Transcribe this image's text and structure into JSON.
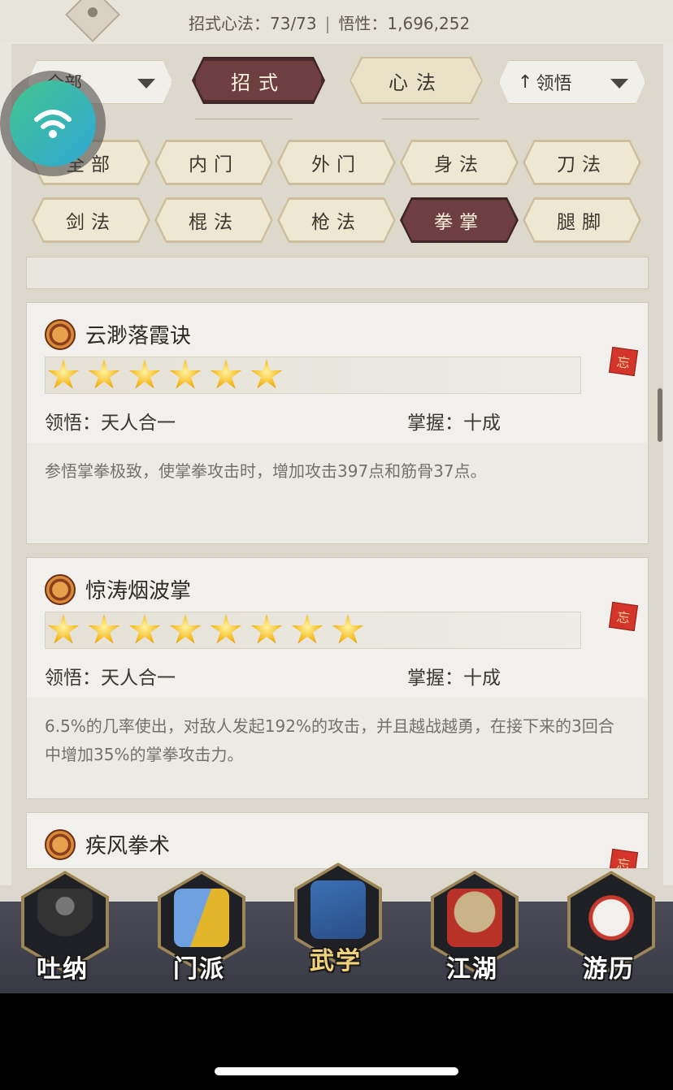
{
  "header": {
    "moves_label": "招式心法：73/73",
    "separator": "|",
    "insight_label": "悟性：1,696,252"
  },
  "filters": {
    "type_dropdown": "全部",
    "sort_dropdown": "领悟"
  },
  "main_tabs": [
    {
      "label": "招式",
      "active": true
    },
    {
      "label": "心法",
      "active": false
    }
  ],
  "categories": [
    {
      "label": "全部",
      "active": false
    },
    {
      "label": "内门",
      "active": false
    },
    {
      "label": "外门",
      "active": false
    },
    {
      "label": "身法",
      "active": false
    },
    {
      "label": "刀法",
      "active": false
    },
    {
      "label": "剑法",
      "active": false
    },
    {
      "label": "棍法",
      "active": false
    },
    {
      "label": "枪法",
      "active": false
    },
    {
      "label": "拳掌",
      "active": true
    },
    {
      "label": "腿脚",
      "active": false
    }
  ],
  "skills": [
    {
      "name": "云渺落霞诀",
      "stars": 6,
      "comprehension": "领悟：天人合一",
      "mastery": "掌握：十成",
      "description": "参悟掌拳极致，使掌拳攻击时，增加攻击397点和筋骨37点。",
      "forget_tag": "忘"
    },
    {
      "name": "惊涛烟波掌",
      "stars": 8,
      "comprehension": "领悟：天人合一",
      "mastery": "掌握：十成",
      "description": "6.5%的几率使出，对敌人发起192%的攻击，并且越战越勇，在接下来的3回合中增加35%的掌拳攻击力。",
      "forget_tag": "忘"
    },
    {
      "name": "疾风拳术",
      "forget_tag": "忘"
    }
  ],
  "bottom_nav": [
    {
      "label": "吐纳",
      "icon": "meditation-figure-icon",
      "active": false
    },
    {
      "label": "门派",
      "icon": "sect-flags-icon",
      "active": false
    },
    {
      "label": "武学",
      "icon": "martial-books-icon",
      "active": true
    },
    {
      "label": "江湖",
      "icon": "straw-hat-icon",
      "active": false
    },
    {
      "label": "游历",
      "icon": "white-horse-icon",
      "active": false
    }
  ],
  "colors": {
    "active_tab": "#6e3f40",
    "inactive_tab": "#e9e1c8",
    "star": "#f4b619",
    "forget_tag": "#d4352a",
    "nav_bg": "#3a3a45"
  }
}
